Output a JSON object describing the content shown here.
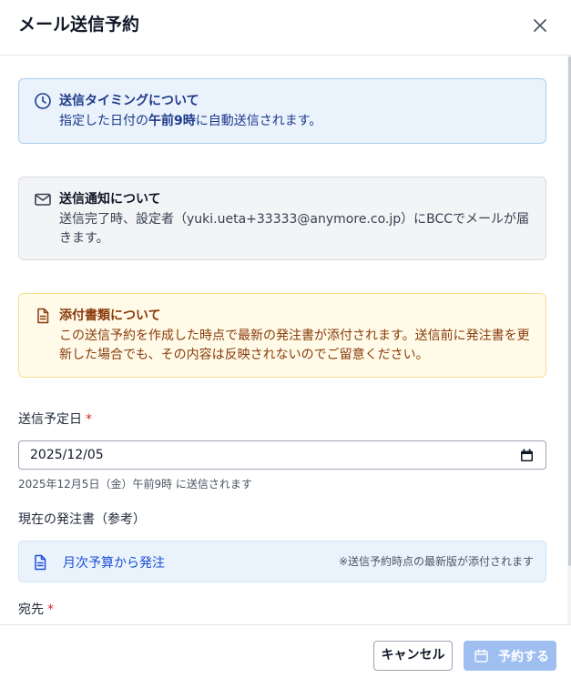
{
  "dialog": {
    "title": "メール送信予約",
    "close_icon": "close-icon"
  },
  "notices": {
    "timing": {
      "icon": "clock-icon",
      "title": "送信タイミングについて",
      "body_before": "指定した日付の",
      "body_bold": "午前9時",
      "body_after": "に自動送信されます。"
    },
    "notify": {
      "icon": "mail-icon",
      "title": "送信通知について",
      "body": "送信完了時、設定者（yuki.ueta+33333@anymore.co.jp）にBCCでメールが届きます。"
    },
    "attachment": {
      "icon": "document-icon",
      "title": "添付書類について",
      "body": "この送信予約を作成した時点で最新の発注書が添付されます。送信前に発注書を更新した場合でも、その内容は反映されないのでご留意ください。"
    }
  },
  "form": {
    "date_label": "送信予定日",
    "required_mark": "*",
    "date_value": "2025/12/05",
    "date_hint": "2025年12月5日（金）午前9時 に送信されます",
    "current_po_label": "現在の発注書（参考）",
    "po_name": "月次予算から発注",
    "po_note": "※送信予約時点の最新版が添付されます",
    "recipient_label": "宛先"
  },
  "footer": {
    "cancel_label": "キャンセル",
    "schedule_label": "予約する",
    "schedule_icon": "calendar-icon"
  },
  "colors": {
    "timing_bg": "#eaf3fc",
    "notify_bg": "#f3f4f6",
    "attach_bg": "#fffbe8",
    "primary_disabled": "#9fbff0",
    "required": "#dc2626"
  }
}
